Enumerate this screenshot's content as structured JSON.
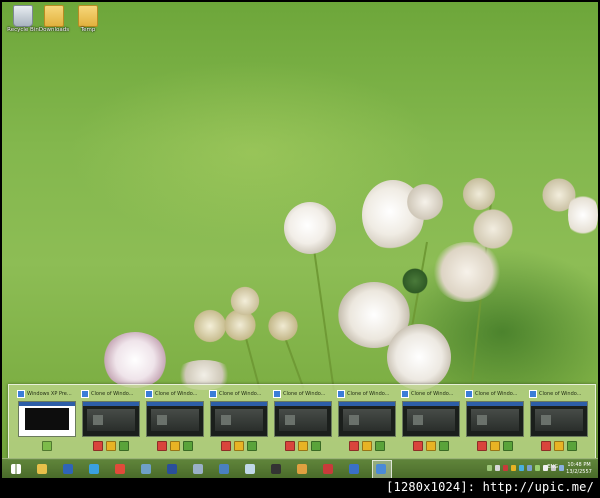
{
  "desktop": {
    "icons": [
      {
        "label": "Recycle Bin",
        "icon": "recycle-bin-icon"
      },
      {
        "label": "Downloads",
        "icon": "folder-icon"
      },
      {
        "label": "Temp",
        "icon": "folder-icon"
      }
    ]
  },
  "preview_strip": {
    "thumbnails": [
      {
        "title": "Windows XP Pre...",
        "kind": "xp",
        "controls": [
          "play"
        ]
      },
      {
        "title": "Clone of Windo...",
        "kind": "clone",
        "controls": [
          "stop",
          "pause",
          "reset"
        ]
      },
      {
        "title": "Clone of Windo...",
        "kind": "clone",
        "controls": [
          "stop",
          "pause",
          "reset"
        ]
      },
      {
        "title": "Clone of Windo...",
        "kind": "clone",
        "controls": [
          "stop",
          "pause",
          "reset"
        ]
      },
      {
        "title": "Clone of Windo...",
        "kind": "clone",
        "controls": [
          "stop",
          "pause",
          "reset"
        ]
      },
      {
        "title": "Clone of Windo...",
        "kind": "clone",
        "controls": [
          "stop",
          "pause",
          "reset"
        ]
      },
      {
        "title": "Clone of Windo...",
        "kind": "clone",
        "controls": [
          "stop",
          "pause",
          "reset"
        ]
      },
      {
        "title": "Clone of Windo...",
        "kind": "clone",
        "controls": [
          "stop",
          "pause",
          "reset"
        ]
      },
      {
        "title": "Clone of Windo...",
        "kind": "clone",
        "controls": [
          "stop",
          "pause",
          "reset"
        ]
      }
    ]
  },
  "taskbar": {
    "buttons": [
      {
        "name": "start-button",
        "icon": "windows-logo-icon",
        "color": "#ffffff"
      },
      {
        "name": "file-explorer",
        "icon": "folder-icon",
        "color": "#e8c04a"
      },
      {
        "name": "app-ms",
        "icon": "app-icon",
        "color": "#2f64b8"
      },
      {
        "name": "internet-explorer",
        "icon": "ie-icon",
        "color": "#3aa0e0"
      },
      {
        "name": "chrome",
        "icon": "chrome-icon",
        "color": "#e04a3a"
      },
      {
        "name": "settings-tool",
        "icon": "gear-icon",
        "color": "#6fa0c8"
      },
      {
        "name": "app-vc",
        "icon": "app-icon",
        "color": "#2a4f9a"
      },
      {
        "name": "media-app",
        "icon": "media-icon",
        "color": "#9ab0c8"
      },
      {
        "name": "network-tool",
        "icon": "network-icon",
        "color": "#4a80c0"
      },
      {
        "name": "notepad",
        "icon": "notepad-icon",
        "color": "#c0d8e8"
      },
      {
        "name": "video-app",
        "icon": "clapper-icon",
        "color": "#333333"
      },
      {
        "name": "paint",
        "icon": "paint-icon",
        "color": "#e0a040"
      },
      {
        "name": "media-player",
        "icon": "record-icon",
        "color": "#c83a3a"
      },
      {
        "name": "windows-8-app",
        "icon": "win8-icon",
        "color": "#3a70c8"
      },
      {
        "name": "virtual-machine",
        "icon": "vm-icon",
        "color": "#4a8ad8",
        "active": true
      }
    ],
    "tray_colors": [
      "#9ec87a",
      "#d8d8d8",
      "#c83a3a",
      "#e8b324",
      "#4ab0e0",
      "#7aa0d0",
      "#9ad070",
      "#f0f0f0",
      "#c8c8c8",
      "#8ab0e0"
    ],
    "language": "ENG",
    "time": "10:48 PM",
    "date": "13/2/2557"
  },
  "caption": "[1280x1024]: http://upic.me/"
}
